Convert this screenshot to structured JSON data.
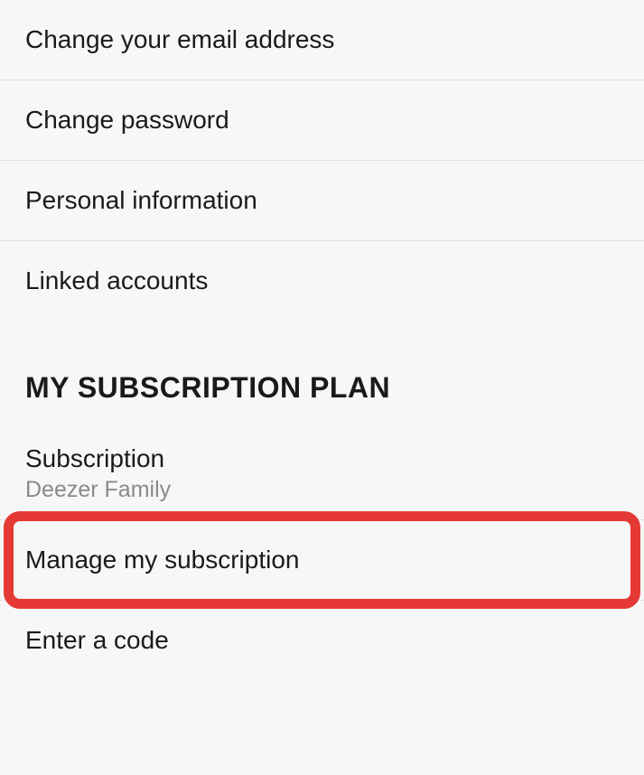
{
  "account_settings": {
    "items": [
      {
        "label": "Change your email address"
      },
      {
        "label": "Change password"
      },
      {
        "label": "Personal information"
      },
      {
        "label": "Linked accounts"
      }
    ]
  },
  "subscription_section": {
    "header": "MY SUBSCRIPTION PLAN",
    "subscription": {
      "label": "Subscription",
      "value": "Deezer Family"
    },
    "manage_label": "Manage my subscription",
    "enter_code_label": "Enter a code"
  }
}
